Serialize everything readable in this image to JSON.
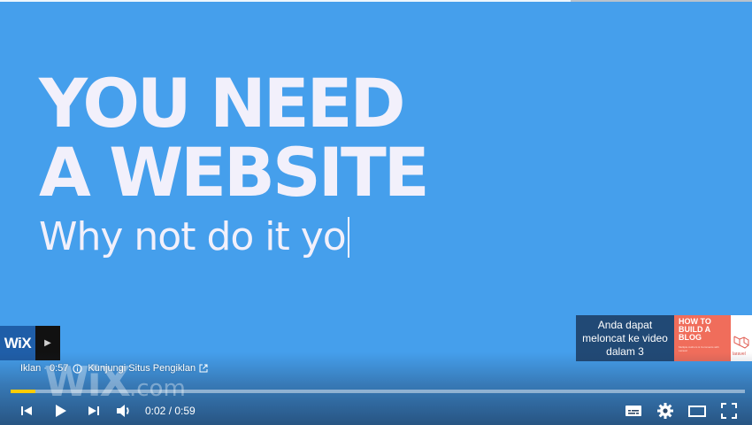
{
  "video": {
    "headline_line1": "YOU NEED",
    "headline_line2": "A WEBSITE",
    "subline": "Why not do it yo"
  },
  "brand": {
    "logo_text": "WiX",
    "watermark_main": "WiX",
    "watermark_suffix": ".com"
  },
  "skip_ad": {
    "text": "Anda dapat meloncat ke video dalam 3",
    "thumbnail_title": "HOW TO BUILD A BLOG",
    "thumbnail_sub": "Multiple Authors & Comments with Laravel",
    "thumbnail_brand": "laravel"
  },
  "ad_info": {
    "label": "Iklan · 0:57",
    "visit_link": "Kunjungi Situs Pengiklan"
  },
  "player": {
    "current_time": "0:02",
    "separator": " / ",
    "duration": "0:59",
    "progress_fraction": 0.034,
    "progress_color": "#ffcc00",
    "background_color": "#459fec"
  },
  "icons": {
    "prev": "skip-previous-icon",
    "play": "play-icon",
    "next": "skip-next-icon",
    "volume": "volume-icon",
    "subtitles": "subtitles-icon",
    "settings": "gear-icon",
    "theater": "theater-mode-icon",
    "fullscreen": "fullscreen-icon"
  }
}
